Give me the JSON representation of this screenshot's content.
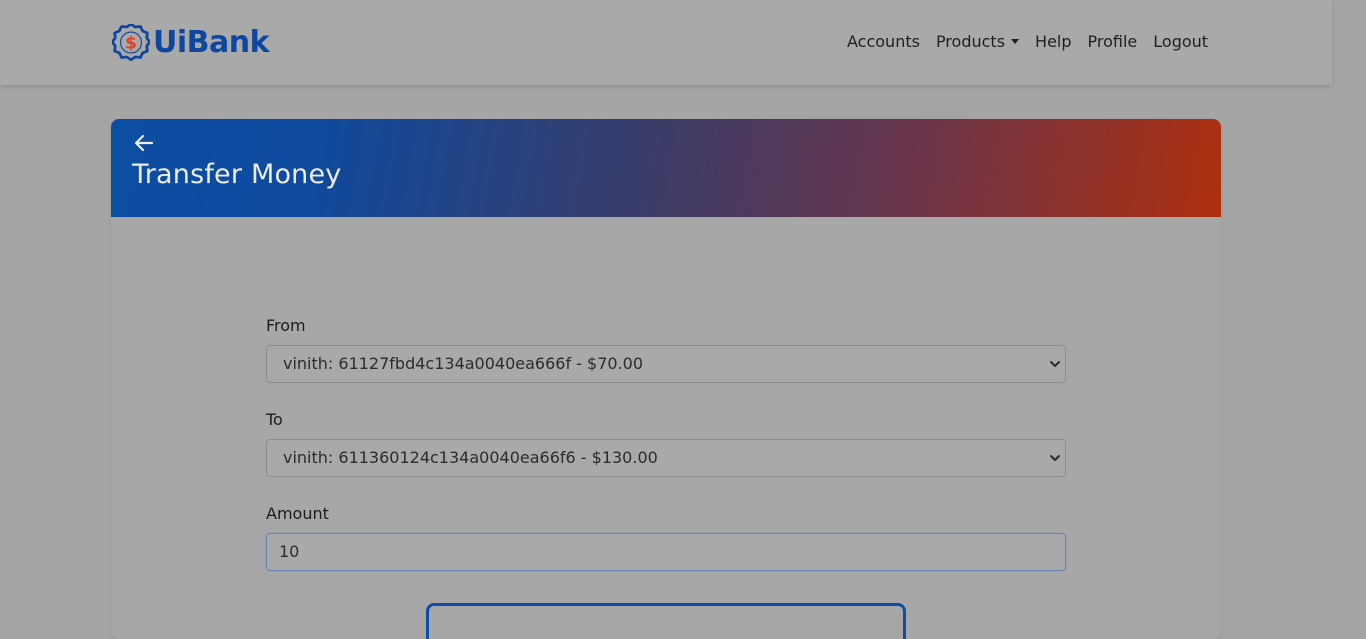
{
  "brand": {
    "name": "UiBank",
    "logo_color": "#0e47a0",
    "logo_accent": "#e0401f"
  },
  "nav": {
    "items": [
      {
        "label": "Accounts"
      },
      {
        "label": "Products",
        "has_dropdown": true
      },
      {
        "label": "Help"
      },
      {
        "label": "Profile"
      },
      {
        "label": "Logout"
      }
    ]
  },
  "page": {
    "title": "Transfer Money",
    "back_icon": "arrow-left-icon",
    "header_gradient": [
      "#0b4ea3",
      "#ae300f"
    ]
  },
  "form": {
    "from_label": "From",
    "from_value": "vinith: 61127fbd4c134a0040ea666f - $70.00",
    "to_label": "To",
    "to_value": "vinith: 611360124c134a0040ea66f6 - $130.00",
    "amount_label": "Amount",
    "amount_value": "10"
  }
}
